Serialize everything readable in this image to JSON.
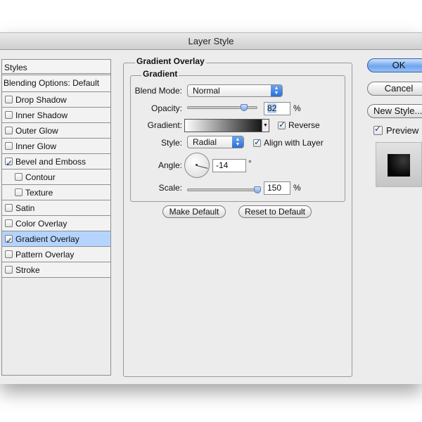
{
  "window": {
    "title": "Layer Style"
  },
  "styles_panel": {
    "header": "Styles",
    "blending_options": "Blending Options: Default",
    "items": [
      {
        "label": "Drop Shadow",
        "checked": false
      },
      {
        "label": "Inner Shadow",
        "checked": false
      },
      {
        "label": "Outer Glow",
        "checked": false
      },
      {
        "label": "Inner Glow",
        "checked": false
      },
      {
        "label": "Bevel and Emboss",
        "checked": true
      },
      {
        "label": "Contour",
        "checked": false
      },
      {
        "label": "Texture",
        "checked": false
      },
      {
        "label": "Satin",
        "checked": false
      },
      {
        "label": "Color Overlay",
        "checked": false
      },
      {
        "label": "Gradient Overlay",
        "checked": true,
        "selected": true
      },
      {
        "label": "Pattern Overlay",
        "checked": false
      },
      {
        "label": "Stroke",
        "checked": false
      }
    ]
  },
  "gradient_overlay": {
    "group_title": "Gradient Overlay",
    "sub_title": "Gradient",
    "blend_mode": {
      "label": "Blend Mode:",
      "value": "Normal"
    },
    "opacity": {
      "label": "Opacity:",
      "value": "82",
      "unit": "%",
      "level": 0.82
    },
    "gradient": {
      "label": "Gradient:",
      "reverse_label": "Reverse",
      "reverse_checked": true,
      "colors": [
        "#ffffff",
        "#000000"
      ]
    },
    "style": {
      "label": "Style:",
      "value": "Radial",
      "align_label": "Align with Layer",
      "align_checked": true
    },
    "angle": {
      "label": "Angle:",
      "value": "-14",
      "unit": "°"
    },
    "scale": {
      "label": "Scale:",
      "value": "150",
      "unit": "%"
    },
    "make_default": "Make Default",
    "reset_default": "Reset to Default"
  },
  "buttons": {
    "ok": "OK",
    "cancel": "Cancel",
    "new_style": "New Style...",
    "preview_label": "Preview",
    "preview_checked": true
  },
  "colors": {
    "accent": "#6ea5ee",
    "selection": "#b5d4fd"
  }
}
